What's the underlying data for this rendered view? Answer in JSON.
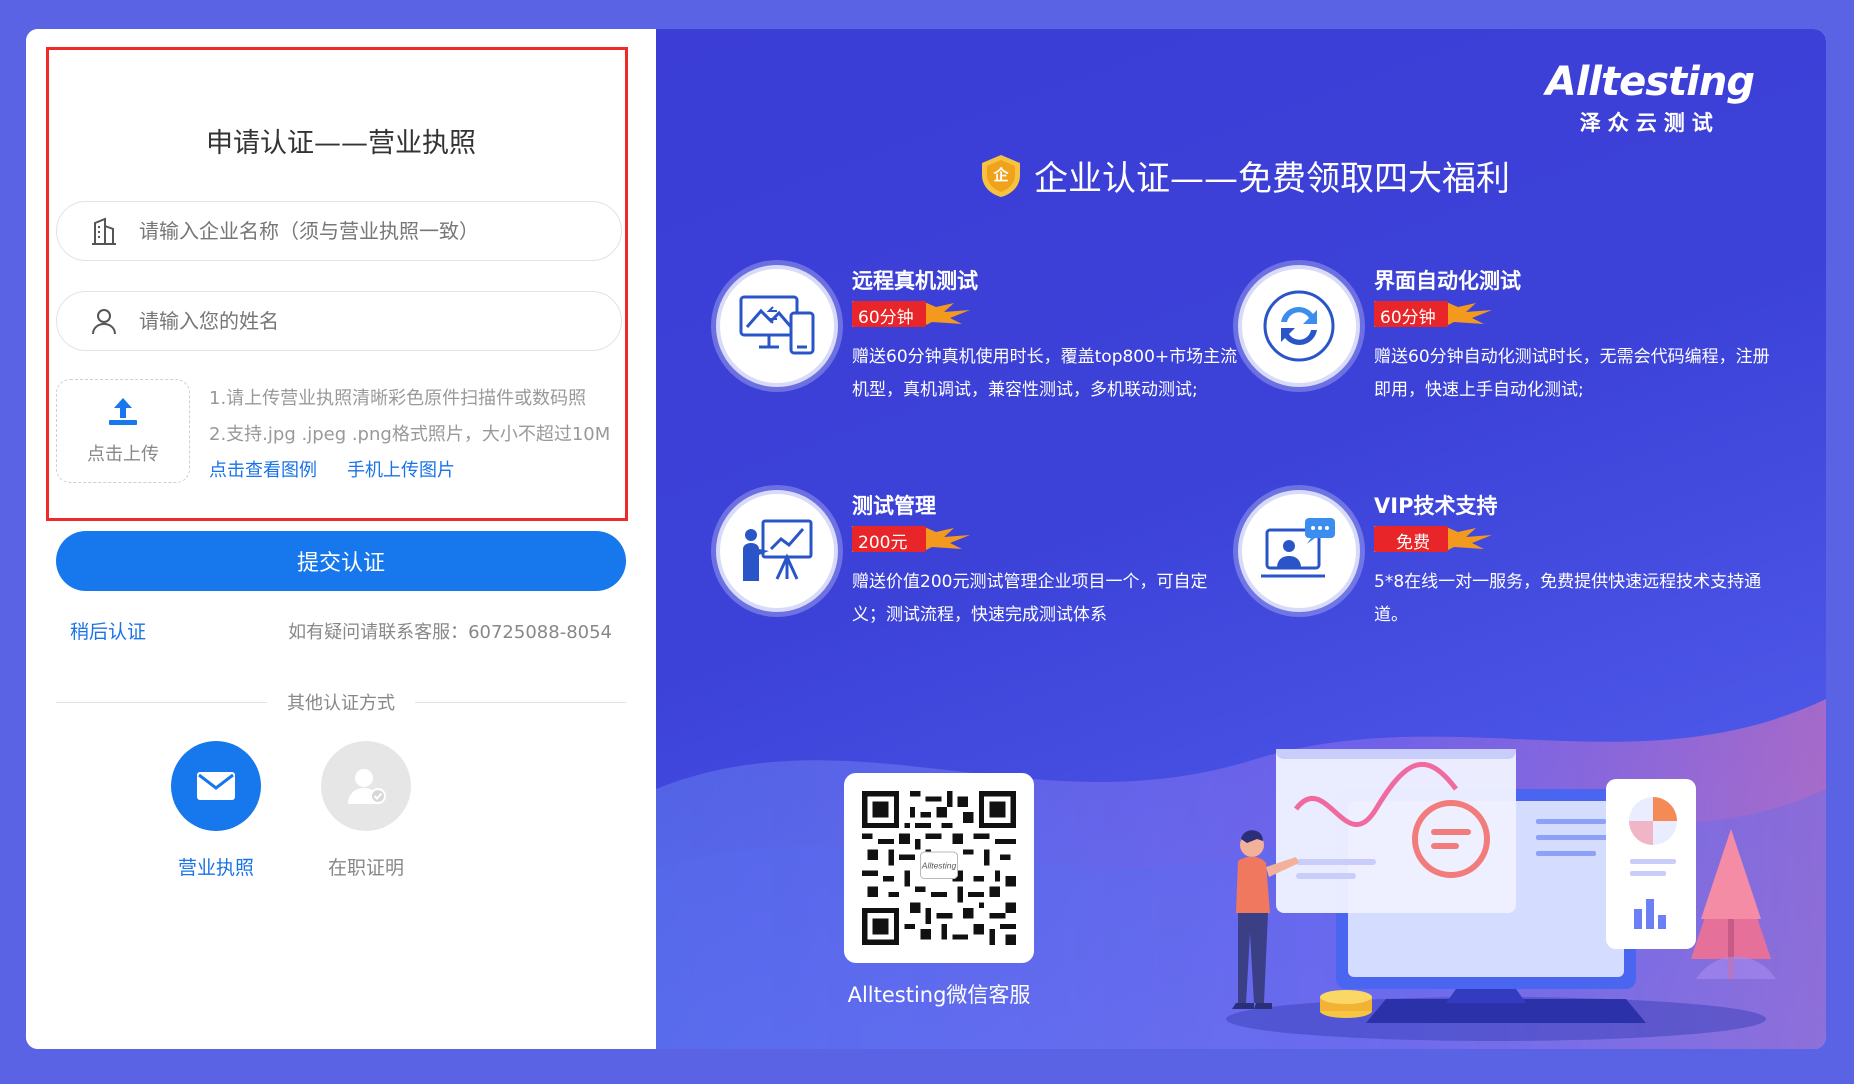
{
  "form": {
    "title": "申请认证——营业执照",
    "company_placeholder": "请输入企业名称（须与营业执照一致）",
    "name_placeholder": "请输入您的姓名",
    "upload_label": "点击上传",
    "tip1": "1.请上传营业执照清晰彩色原件扫描件或数码照",
    "tip2": "2.支持.jpg .jpeg .png格式照片，大小不超过10M",
    "view_example": "点击查看图例",
    "mobile_upload": "手机上传图片",
    "submit_label": "提交认证",
    "later_label": "稍后认证",
    "contact": "如有疑问请联系客服：60725088-8054",
    "other_methods": "其他认证方式",
    "method_license": "营业执照",
    "method_employment": "在职证明"
  },
  "colors": {
    "accent": "#1777ec",
    "link": "#1a73e8",
    "highlight_border": "#ef2a2a",
    "page_bg": "#5a63e3",
    "badge": "#e8262a"
  },
  "promo": {
    "logo_name": "Alltesting",
    "logo_sub": "泽众云测试",
    "headline_badge": "企",
    "headline": "企业认证——免费领取四大福利",
    "benefits": [
      {
        "title": "远程真机测试",
        "badge": "60分钟",
        "desc": "赠送60分钟真机使用时长，覆盖top800+市场主流机型，真机调试，兼容性测试，多机联动测试;",
        "icon": "monitor-phone-icon"
      },
      {
        "title": "界面自动化测试",
        "badge": "60分钟",
        "desc": "赠送60分钟自动化测试时长，无需会代码编程，注册即用，快速上手自动化测试;",
        "icon": "refresh-icon"
      },
      {
        "title": "测试管理",
        "badge": "200元",
        "desc": "赠送价值200元测试管理企业项目一个，可自定义；测试流程，快速完成测试体系",
        "icon": "presentation-icon"
      },
      {
        "title": "VIP技术支持",
        "badge": "免费",
        "desc": "5*8在线一对一服务，免费提供快速远程技术支持通道。",
        "icon": "support-chat-icon"
      }
    ],
    "qr_center": "Alltesting",
    "qr_label": "Alltesting微信客服"
  }
}
